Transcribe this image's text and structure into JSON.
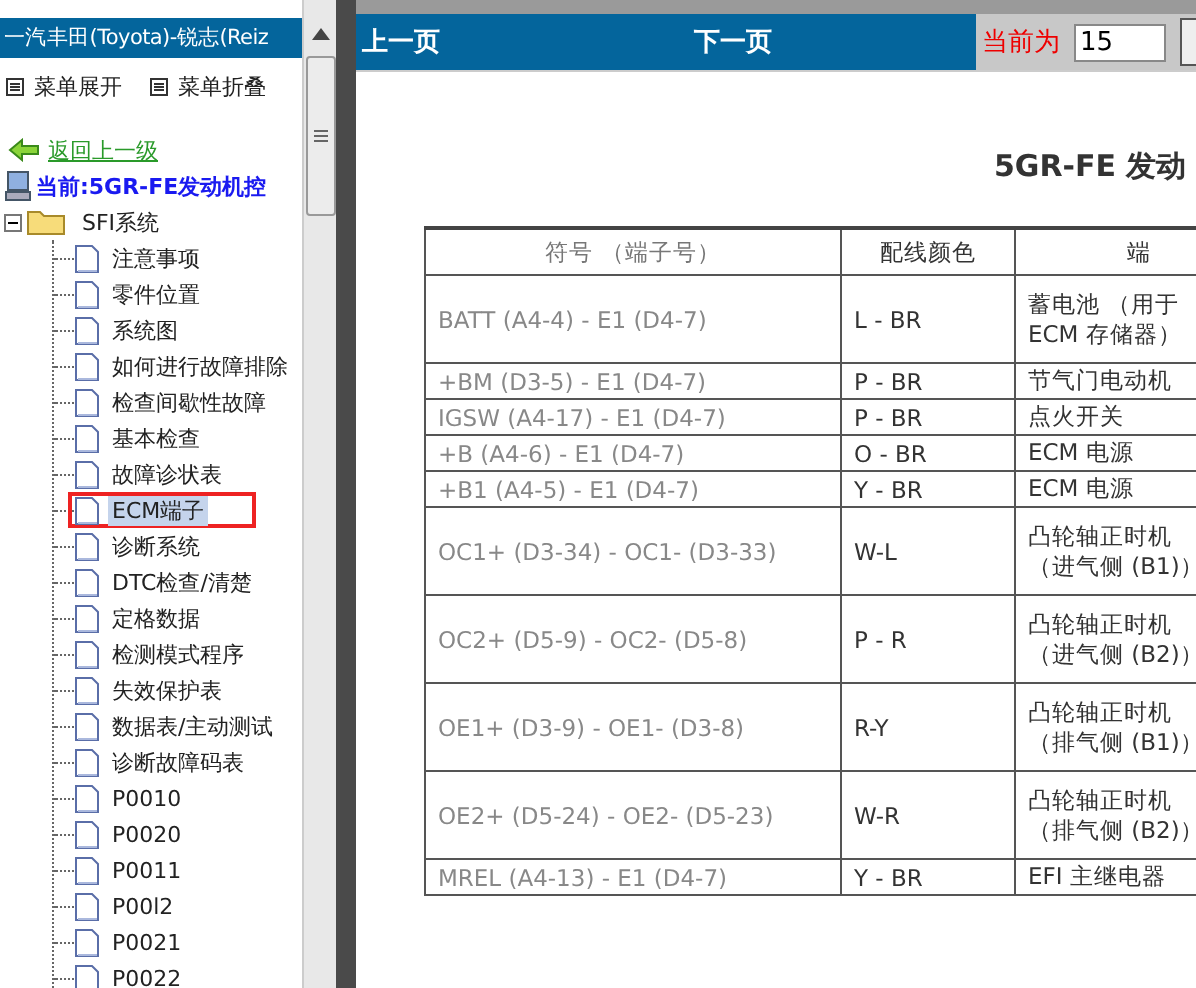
{
  "sidebar": {
    "title": "一汽丰田(Toyota)-锐志(Reiz",
    "menu": [
      "菜单展开",
      "菜单折叠"
    ],
    "back_link": "返回上一级",
    "current": "当前:5GR-FE发动机控",
    "tree": [
      {
        "label": "SFI系统",
        "expanded": true,
        "children": [
          {
            "label": "注意事项",
            "selected": false
          },
          {
            "label": "零件位置",
            "selected": false
          },
          {
            "label": "系统图",
            "selected": false
          },
          {
            "label": "如何进行故障排除",
            "selected": false
          },
          {
            "label": "检查间歇性故障",
            "selected": false
          },
          {
            "label": "基本检查",
            "selected": false
          },
          {
            "label": "故障诊状表",
            "selected": false
          },
          {
            "label": "ECM端子",
            "selected": true
          },
          {
            "label": "诊断系统",
            "selected": false
          },
          {
            "label": "DTC检查/清楚",
            "selected": false
          },
          {
            "label": "定格数据",
            "selected": false
          },
          {
            "label": "检测模式程序",
            "selected": false
          },
          {
            "label": "失效保护表",
            "selected": false
          },
          {
            "label": "数据表/主动测试",
            "selected": false
          },
          {
            "label": "诊断故障码表",
            "selected": false
          },
          {
            "label": "P0010",
            "selected": false
          },
          {
            "label": "P0020",
            "selected": false
          },
          {
            "label": "P0011",
            "selected": false
          },
          {
            "label": "P00l2",
            "selected": false
          },
          {
            "label": "P0021",
            "selected": false
          },
          {
            "label": "P0022",
            "selected": false
          }
        ]
      }
    ]
  },
  "viewer": {
    "prev": "上一页",
    "next": "下一页",
    "page_label": "当前为",
    "page_value": "15",
    "document": {
      "title": "5GR-FE 发动",
      "columns": [
        "符号 （端子号）",
        "配线颜色",
        "端"
      ],
      "rows": [
        {
          "terminal": "BATT (A4-4) - E1 (D4-7)",
          "wire": "L - BR",
          "description": [
            "蓄电池 （用于",
            "ECM 存储器）"
          ]
        },
        {
          "terminal": "+BM (D3-5) - E1 (D4-7)",
          "wire": "P - BR",
          "description": [
            "节气门电动机"
          ]
        },
        {
          "terminal": "IGSW (A4-17) - E1 (D4-7)",
          "wire": "P - BR",
          "description": [
            "点火开关"
          ]
        },
        {
          "terminal": "+B (A4-6) - E1 (D4-7)",
          "wire": "O - BR",
          "description": [
            "ECM 电源"
          ]
        },
        {
          "terminal": "+B1 (A4-5) - E1 (D4-7)",
          "wire": "Y - BR",
          "description": [
            "ECM 电源"
          ]
        },
        {
          "terminal": "OC1+ (D3-34) - OC1- (D3-33)",
          "wire": "W-L",
          "description": [
            "凸轮轴正时机",
            "（进气侧 (B1)）"
          ]
        },
        {
          "terminal": "OC2+ (D5-9) - OC2- (D5-8)",
          "wire": "P - R",
          "description": [
            "凸轮轴正时机",
            "（进气侧 (B2)）"
          ]
        },
        {
          "terminal": "OE1+ (D3-9) - OE1- (D3-8)",
          "wire": "R-Y",
          "description": [
            "凸轮轴正时机",
            "（排气侧 (B1)）"
          ]
        },
        {
          "terminal": "OE2+ (D5-24) - OE2- (D5-23)",
          "wire": "W-R",
          "description": [
            "凸轮轴正时机",
            "（排气侧 (B2)）"
          ]
        },
        {
          "terminal": "MREL (A4-13) - E1 (D4-7)",
          "wire": "Y - BR",
          "description": [
            "EFI 主继电器"
          ]
        }
      ]
    }
  }
}
